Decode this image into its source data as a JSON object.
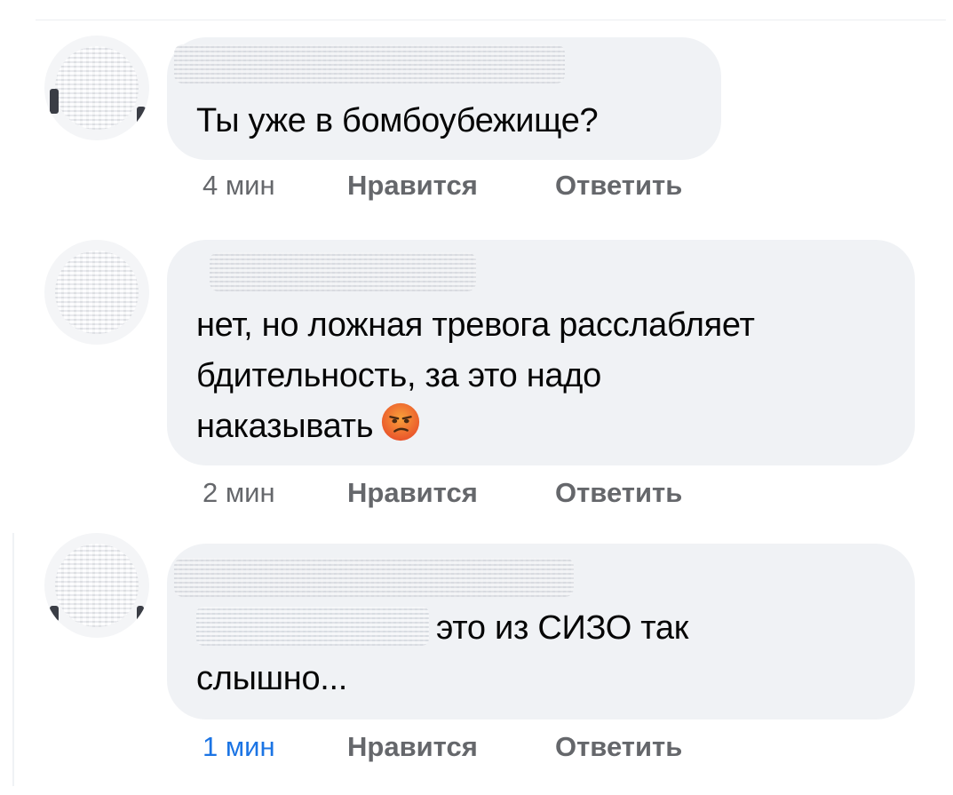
{
  "comments": [
    {
      "text": "Ты уже в бомбоубежище?",
      "time": "4 мин",
      "like_label": "Нравится",
      "reply_label": "Ответить"
    },
    {
      "text_line1": "нет, но ложная тревога расслабляет",
      "text_line2": "бдительность, за это надо",
      "text_line3": "наказывать",
      "emoji": "😒",
      "time": "2 мин",
      "like_label": "Нравится",
      "reply_label": "Ответить"
    },
    {
      "text_line1": "это из СИЗО так",
      "text_line2": "слышно...",
      "time": "1 мин",
      "like_label": "Нравится",
      "reply_label": "Ответить"
    }
  ],
  "colors": {
    "bubble": "#f0f2f5",
    "meta_gray": "#65676b",
    "accent_time": "#1b74e4",
    "text": "#050505"
  }
}
